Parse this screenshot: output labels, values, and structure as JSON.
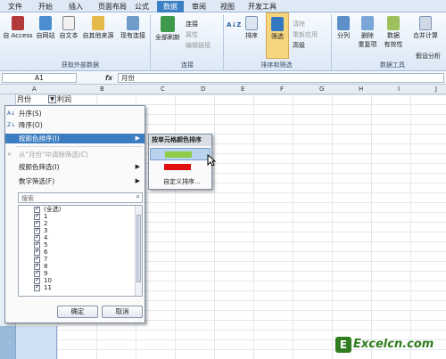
{
  "tabs": [
    "文件",
    "开始",
    "插入",
    "页面布局",
    "公式",
    "数据",
    "审阅",
    "视图",
    "开发工具"
  ],
  "active_tab": "数据",
  "ribbon": {
    "external": {
      "access": "自 Access",
      "web": "自网站",
      "text": "自文本",
      "other": "自其他来源",
      "existing": "现有连接",
      "group_label": "获取外部数据"
    },
    "connections": {
      "refresh_all": "全部刷新",
      "connections": "连接",
      "properties": "属性",
      "edit_links": "编辑链接",
      "group_label": "连接"
    },
    "sort_filter": {
      "sort": "排序",
      "filter": "筛选",
      "clear": "清除",
      "reapply": "重新应用",
      "advanced": "高级",
      "group_label": "排序和筛选"
    },
    "tools": {
      "split": "分列",
      "remove_dup": "删除\n重复项",
      "validation": "数据\n有效性",
      "consolidate": "合并计算",
      "whatif": "假设分析",
      "group_label": "数据工具"
    }
  },
  "formula_bar": {
    "name_box": "A1",
    "fx": "fx",
    "value": "月份"
  },
  "columns": [
    "A",
    "B",
    "C",
    "D",
    "E",
    "F",
    "G",
    "H",
    "I",
    "J"
  ],
  "cells": {
    "a1": "月份",
    "b1": "利润"
  },
  "rows_bottom": [
    "25",
    "26"
  ],
  "filter_menu": {
    "sort_asc": "升序(S)",
    "sort_desc": "降序(O)",
    "sort_by_color": "按颜色排序(I)",
    "clear_filter": "从\"月份\"中清除筛选(C)",
    "filter_by_color": "按颜色筛选(I)",
    "number_filter": "数字筛选(F)",
    "search_placeholder": "搜索",
    "list": [
      "(全选)",
      "1",
      "2",
      "3",
      "4",
      "5",
      "6",
      "7",
      "8",
      "9",
      "10",
      "11"
    ],
    "ok": "确定",
    "cancel": "取消"
  },
  "submenu": {
    "header": "按单元格颜色排序",
    "colors": [
      "#8fcc4a",
      "#e01010"
    ],
    "custom": "自定义排序..."
  },
  "watermark": "Excelcn.com"
}
